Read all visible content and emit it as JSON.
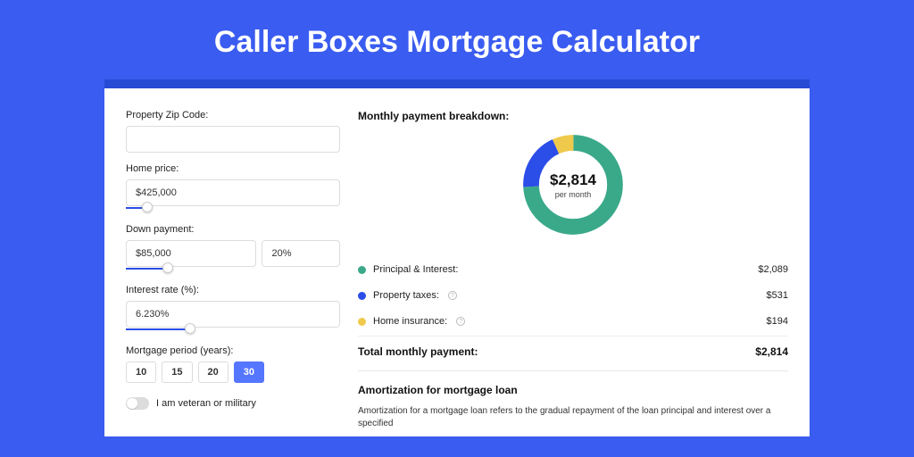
{
  "title": "Caller Boxes Mortgage Calculator",
  "form": {
    "zip_label": "Property Zip Code:",
    "zip_value": "",
    "price_label": "Home price:",
    "price_value": "$425,000",
    "down_label": "Down payment:",
    "down_value": "$85,000",
    "down_pct": "20%",
    "rate_label": "Interest rate (%):",
    "rate_value": "6.230%",
    "period_label": "Mortgage period (years):",
    "periods": [
      "10",
      "15",
      "20",
      "30"
    ],
    "period_active": "30",
    "veteran_label": "I am veteran or military"
  },
  "breakdown": {
    "title": "Monthly payment breakdown:",
    "center_amount": "$2,814",
    "center_sub": "per month",
    "items": [
      {
        "label": "Principal & Interest:",
        "amount": "$2,089",
        "color": "#3aa98a"
      },
      {
        "label": "Property taxes:",
        "amount": "$531",
        "color": "#2b4de8",
        "info": true
      },
      {
        "label": "Home insurance:",
        "amount": "$194",
        "color": "#efc94c",
        "info": true
      }
    ],
    "total_label": "Total monthly payment:",
    "total_amount": "$2,814"
  },
  "amort": {
    "title": "Amortization for mortgage loan",
    "text": "Amortization for a mortgage loan refers to the gradual repayment of the loan principal and interest over a specified"
  },
  "chart_data": {
    "type": "pie",
    "title": "Monthly payment breakdown",
    "values": [
      2089,
      531,
      194
    ],
    "categories": [
      "Principal & Interest",
      "Property taxes",
      "Home insurance"
    ],
    "colors": [
      "#3aa98a",
      "#2b4de8",
      "#efc94c"
    ],
    "total": 2814
  }
}
